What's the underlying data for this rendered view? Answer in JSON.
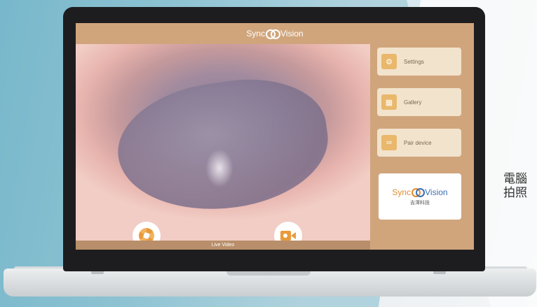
{
  "window": {
    "title_left": "Sync",
    "title_right": "Vision"
  },
  "video": {
    "status_label": "Live Video"
  },
  "menu": {
    "settings_label": "Settings",
    "gallery_label": "Gallery",
    "pair_label": "Pair device"
  },
  "brand": {
    "name_left": "Sync",
    "name_right": "Vision",
    "subtitle": "吉澤科技"
  },
  "side_text": {
    "line1": "電腦",
    "line2": "拍照"
  },
  "colors": {
    "accent": "#e89a3b",
    "panel_bg": "#d0a57c",
    "button_bg": "#f2e3cd"
  }
}
